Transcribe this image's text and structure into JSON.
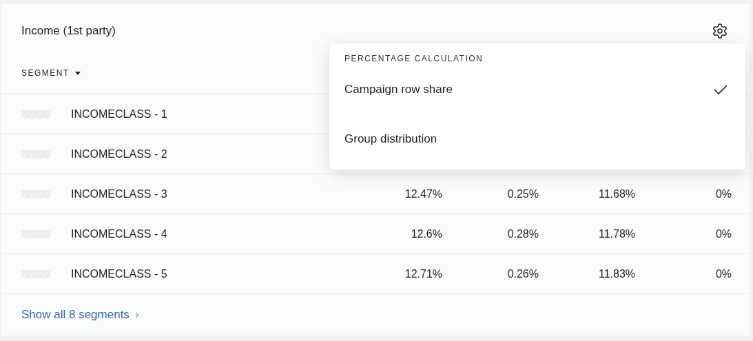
{
  "card": {
    "title": "Income (1st party)"
  },
  "table": {
    "segment_header": "SEGMENT",
    "rows": [
      {
        "segment": "INCOMECLASS - 1"
      },
      {
        "segment": "INCOMECLASS - 2"
      },
      {
        "segment": "INCOMECLASS - 3",
        "values": [
          "12.47%",
          "0.25%",
          "11.68%",
          "0%"
        ]
      },
      {
        "segment": "INCOMECLASS - 4",
        "values": [
          "12.6%",
          "0.28%",
          "11.78%",
          "0%"
        ]
      },
      {
        "segment": "INCOMECLASS - 5",
        "values": [
          "12.71%",
          "0.26%",
          "11.83%",
          "0%"
        ]
      }
    ]
  },
  "footer_link": {
    "label": "Show all 8 segments",
    "chevron": "›"
  },
  "menu": {
    "header": "PERCENTAGE CALCULATION",
    "options": [
      {
        "label": "Campaign row share",
        "selected": true
      },
      {
        "label": "Group distribution",
        "selected": false
      }
    ]
  }
}
